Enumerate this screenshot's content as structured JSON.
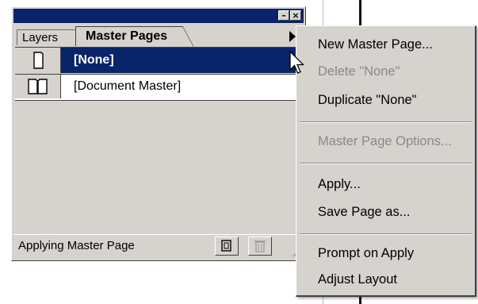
{
  "palette": {
    "title_buttons": {
      "minimize": "–",
      "close": "×"
    },
    "tabs": [
      {
        "label": "Layers"
      },
      {
        "label": "Master Pages"
      }
    ],
    "rows": [
      {
        "label": "[None]",
        "icon": "single-page-icon",
        "selected": true
      },
      {
        "label": "[Document Master]",
        "icon": "spread-pages-icon",
        "selected": false
      }
    ],
    "status": {
      "text": "Applying Master Page"
    },
    "buttons": [
      {
        "icon": "new-master-page-icon"
      },
      {
        "icon": "trash-icon"
      }
    ]
  },
  "menu": {
    "items": [
      {
        "label": "New Master Page...",
        "enabled": true
      },
      {
        "label": "Delete \"None\"",
        "enabled": false
      },
      {
        "label": "Duplicate \"None\"",
        "enabled": true
      },
      {
        "label": "Master Page Options...",
        "enabled": false
      },
      {
        "label": "Apply...",
        "enabled": true
      },
      {
        "label": "Save Page as...",
        "enabled": true
      },
      {
        "label": "Prompt on Apply",
        "enabled": true
      },
      {
        "label": "Adjust Layout",
        "enabled": true
      }
    ]
  },
  "colors": {
    "title_bar": "#0a246a",
    "selection": "#0a246a",
    "face": "#d6d3ce",
    "disabled_text": "#8b8985"
  }
}
